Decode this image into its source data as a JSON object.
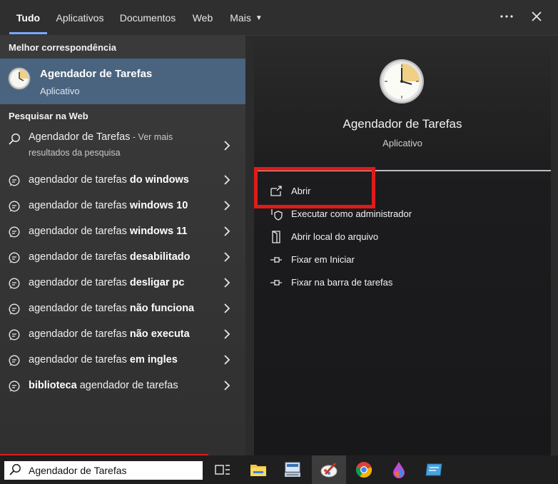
{
  "tabs": [
    {
      "label": "Tudo",
      "active": true
    },
    {
      "label": "Aplicativos",
      "active": false
    },
    {
      "label": "Documentos",
      "active": false
    },
    {
      "label": "Web",
      "active": false
    },
    {
      "label": "Mais",
      "active": false
    }
  ],
  "top_icons": [
    "more-icon",
    "close-icon"
  ],
  "left": {
    "best_match_title": "Melhor correspondência",
    "best_match": {
      "name": "Agendador de Tarefas",
      "type": "Aplicativo",
      "icon": "clock-icon"
    },
    "web_title": "Pesquisar na Web",
    "web_first": {
      "query": "Agendador de Tarefas",
      "more_a": " - Ver mais",
      "more_b": "resultados da pesquisa"
    },
    "web_suggestions": [
      {
        "plain": "agendador de tarefas ",
        "bold": "do windows"
      },
      {
        "plain": "agendador de tarefas ",
        "bold": "windows 10"
      },
      {
        "plain": "agendador de tarefas ",
        "bold": "windows 11"
      },
      {
        "plain": "agendador de tarefas ",
        "bold": "desabilitado"
      },
      {
        "plain": "agendador de tarefas ",
        "bold": "desligar pc"
      },
      {
        "plain": "agendador de tarefas ",
        "bold": "não funciona"
      },
      {
        "plain": "agendador de tarefas ",
        "bold": "não executa"
      },
      {
        "plain": "agendador de tarefas ",
        "bold": "em ingles"
      }
    ],
    "web_last": {
      "bold": "biblioteca",
      "plain": " agendador de tarefas"
    }
  },
  "right": {
    "title": "Agendador de Tarefas",
    "subtitle": "Aplicativo",
    "actions": [
      {
        "label": "Abrir",
        "icon": "open-icon"
      },
      {
        "label": "Executar como administrador",
        "icon": "admin-shield-icon"
      },
      {
        "label": "Abrir local do arquivo",
        "icon": "file-location-icon"
      },
      {
        "label": "Fixar em Iniciar",
        "icon": "pin-icon"
      },
      {
        "label": "Fixar na barra de tarefas",
        "icon": "pin-icon"
      }
    ]
  },
  "taskbar": {
    "search_value": "Agendador de Tarefas",
    "apps": [
      "task-view-icon",
      "file-explorer-icon",
      "pc-app-icon",
      "paint-icon",
      "chrome-icon",
      "color-drop-app-icon",
      "card-app-icon"
    ]
  },
  "colors": {
    "highlight": "#e11a1a",
    "best_match_bg": "#4a6480",
    "tab_underline": "#7aa8ff"
  }
}
